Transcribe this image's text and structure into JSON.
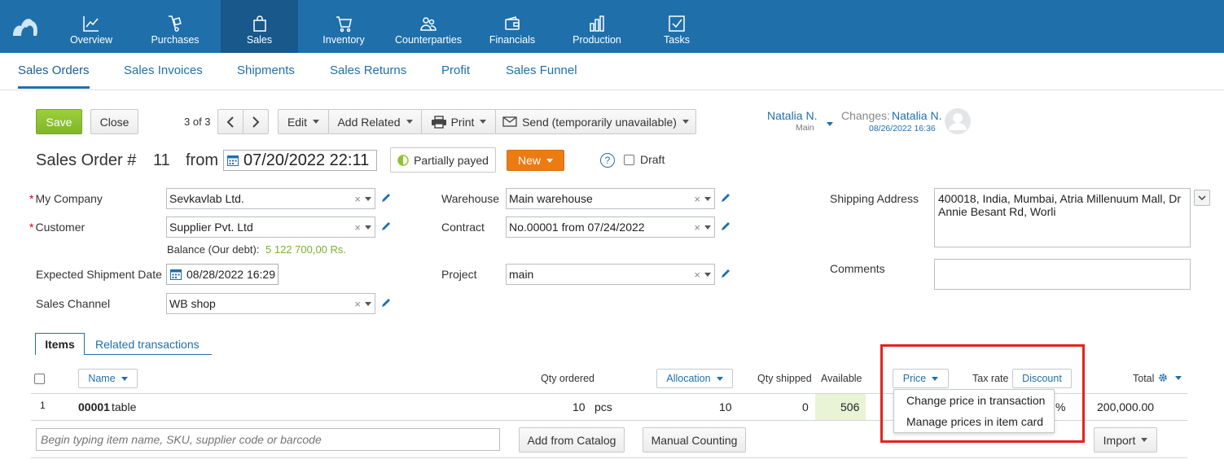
{
  "nav": [
    {
      "label": "Overview",
      "icon": "chart-line-icon",
      "active": false
    },
    {
      "label": "Purchases",
      "icon": "hand-truck-icon",
      "active": false
    },
    {
      "label": "Sales",
      "icon": "shopping-bag-icon",
      "active": true
    },
    {
      "label": "Inventory",
      "icon": "cart-icon",
      "active": false
    },
    {
      "label": "Counterparties",
      "icon": "users-icon",
      "active": false
    },
    {
      "label": "Financials",
      "icon": "wallet-icon",
      "active": false
    },
    {
      "label": "Production",
      "icon": "bar-chart-icon",
      "active": false
    },
    {
      "label": "Tasks",
      "icon": "checkbox-icon",
      "active": false
    }
  ],
  "subnav": [
    "Sales Orders",
    "Sales Invoices",
    "Shipments",
    "Sales Returns",
    "Profit",
    "Sales Funnel"
  ],
  "toolbar": {
    "save": "Save",
    "close": "Close",
    "pager": "3 of 3",
    "edit": "Edit",
    "add_related": "Add Related",
    "print": "Print",
    "send": "Send (temporarily unavailable)"
  },
  "user": {
    "owner": "Natalia N.",
    "owner_group": "Main",
    "changes_label": "Changes:",
    "changes_by": "Natalia N.",
    "changes_time": "08/26/2022 16:36"
  },
  "order": {
    "title": "Sales Order #",
    "number": "11",
    "from": "from",
    "date": "07/20/2022 22:11",
    "payment_status": "Partially payed",
    "state": "New",
    "help": "?",
    "draft": "Draft"
  },
  "form": {
    "my_company_label": "My Company",
    "my_company": "Sevkavlab Ltd.",
    "customer_label": "Customer",
    "customer": "Supplier Pvt. Ltd",
    "balance_label": "Balance (Our debt):",
    "balance_value": "5 122 700,00 Rs.",
    "shipment_date_label": "Expected Shipment Date",
    "shipment_date": "08/28/2022 16:29",
    "channel_label": "Sales Channel",
    "channel": "WB shop",
    "warehouse_label": "Warehouse",
    "warehouse": "Main warehouse",
    "contract_label": "Contract",
    "contract": "No.00001 from 07/24/2022",
    "project_label": "Project",
    "project": "main",
    "shipping_label": "Shipping Address",
    "shipping": "400018, India, Mumbai, Atria Millenuum Mall, Dr Annie Besant Rd, Worli",
    "comments_label": "Comments",
    "comments": ""
  },
  "tabs": {
    "items": "Items",
    "related": "Related transactions"
  },
  "table": {
    "headers": {
      "name": "Name",
      "qty_ordered": "Qty ordered",
      "allocation": "Allocation",
      "qty_shipped": "Qty shipped",
      "available": "Available",
      "price": "Price",
      "tax_rate": "Tax rate",
      "discount": "Discount",
      "total": "Total"
    },
    "rows": [
      {
        "index": "1",
        "code": "00001",
        "name": "table",
        "qty": "10",
        "unit": "pcs",
        "allocation": "10",
        "shipped": "0",
        "available": "506",
        "tax": "%",
        "total": "200,000.00"
      }
    ]
  },
  "price_menu": [
    "Change price in transaction",
    "Manage prices in item card"
  ],
  "bottom": {
    "search_placeholder": "Begin typing item name, SKU, supplier code or barcode",
    "add_from_catalog": "Add from Catalog",
    "manual_counting": "Manual Counting",
    "import": "Import"
  },
  "colors": {
    "brand": "#1f6fab",
    "save": "#8cc332",
    "state": "#ec7b12",
    "highlight": "#e3241b",
    "available_bg": "#e9f3d6"
  }
}
